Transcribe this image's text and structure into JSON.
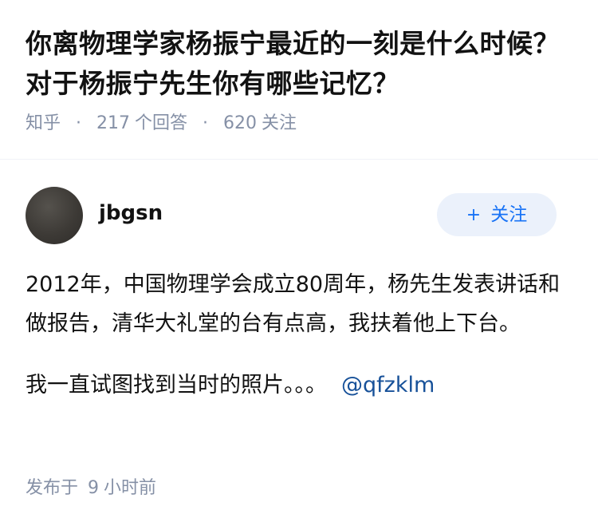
{
  "question": {
    "title": "你离物理学家杨振宁最近的一刻是什么时候？对于杨振宁先生你有哪些记忆？",
    "site": "知乎",
    "separator": "·",
    "answer_count": "217",
    "answer_label": "个回答",
    "follower_count": "620",
    "follower_label": "关注"
  },
  "answer": {
    "author_name": "jbgsn",
    "follow_button_label": "关注",
    "follow_button_icon": "+",
    "paragraphs": [
      "2012年，中国物理学会成立80周年，杨先生发表讲话和做报告，清华大礼堂的台有点高，我扶着他上下台。",
      "我一直试图找到当时的照片。。。"
    ],
    "mention": "@qfzklm",
    "publish_prefix": "发布于",
    "publish_number": "9",
    "publish_suffix": "小时前"
  },
  "colors": {
    "title_text": "#121212",
    "meta_text": "#8590a6",
    "follow_button_bg": "#ebf1fb",
    "follow_button_text": "#1772f6",
    "mention_link": "#175199",
    "divider": "#f0f2f7"
  }
}
